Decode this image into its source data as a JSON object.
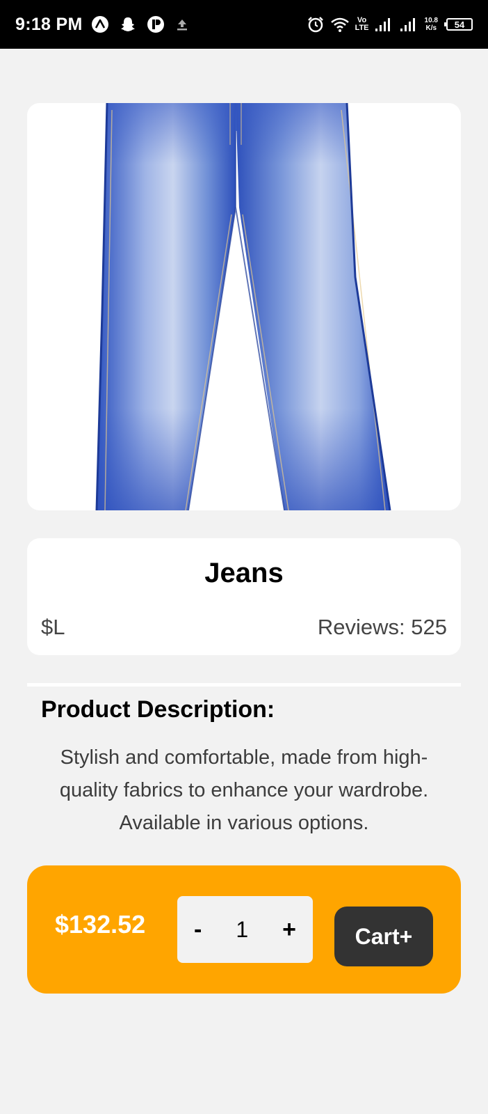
{
  "status_bar": {
    "time": "9:18 PM",
    "network_top": "Vo",
    "network_bottom": "LTE",
    "speed_value": "10.8",
    "speed_unit": "K/s",
    "battery": "54",
    "left_icons": [
      "expo-icon",
      "snapchat-icon",
      "app-icon",
      "upload-icon"
    ],
    "right_icons": [
      "alarm-icon",
      "wifi-icon",
      "signal-icon",
      "signal-icon",
      "battery-icon"
    ]
  },
  "product": {
    "image_icon": "jeans-image",
    "title": "Jeans",
    "size": "$L",
    "reviews": "Reviews: 525"
  },
  "description": {
    "heading": "Product Description:",
    "text": "Stylish and comfortable, made from high-quality fabrics to enhance your wardrobe. Available in various options."
  },
  "action_bar": {
    "price": "$132.52",
    "decrement_label": "-",
    "quantity": "1",
    "increment_label": "+",
    "cart_label": "Cart+"
  },
  "colors": {
    "accent": "#ffa500",
    "cart_button": "#333333",
    "background": "#f2f2f2",
    "denim": "#3a5fc4"
  }
}
